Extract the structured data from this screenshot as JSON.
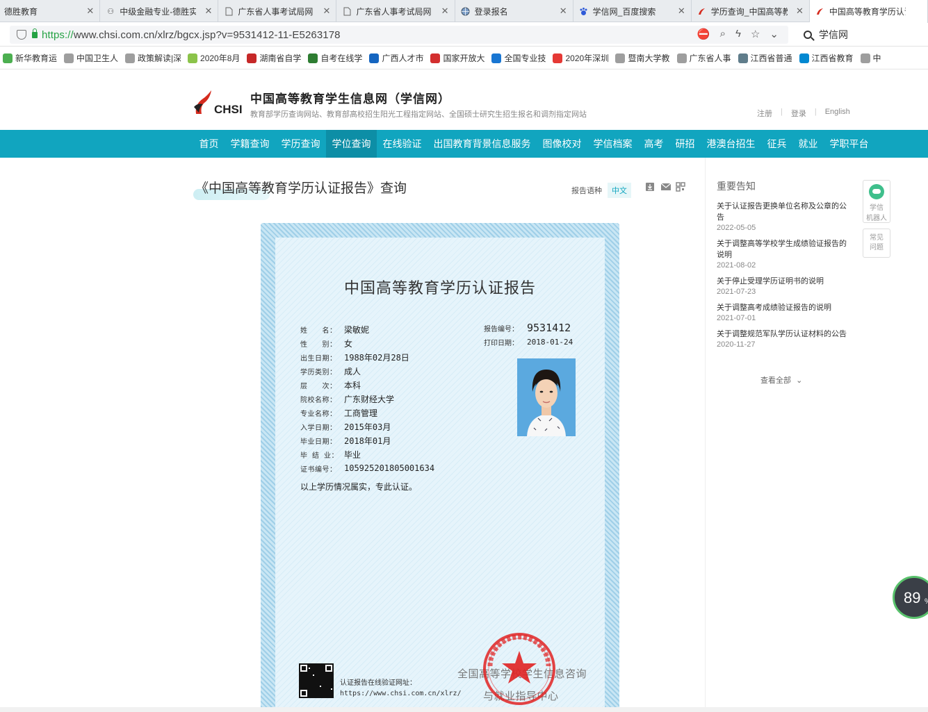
{
  "tabs": [
    {
      "label": "德胜教育",
      "icon": "none"
    },
    {
      "label": "中级金融专业-德胜实",
      "icon": "logo"
    },
    {
      "label": "广东省人事考试局网",
      "icon": "doc"
    },
    {
      "label": "广东省人事考试局网",
      "icon": "doc"
    },
    {
      "label": "登录报名",
      "icon": "globe"
    },
    {
      "label": "学信网_百度搜索",
      "icon": "baidu"
    },
    {
      "label": "学历查询_中国高等教",
      "icon": "chsi"
    },
    {
      "label": "中国高等教育学历认证",
      "icon": "chsi"
    }
  ],
  "address": {
    "scheme": "https://",
    "rest": "www.chsi.com.cn/xlrz/bgcx.jsp?v=9531412-11-E5263178",
    "search_text": "学信网"
  },
  "bookmarks": [
    {
      "label": "新华教育运",
      "color": "#4caf50"
    },
    {
      "label": "中国卫生人",
      "color": "#9e9e9e"
    },
    {
      "label": "政策解读|深",
      "color": "#9e9e9e"
    },
    {
      "label": "2020年8月",
      "color": "#8bc34a"
    },
    {
      "label": "湖南省自学",
      "color": "#c62828"
    },
    {
      "label": "自考在线学",
      "color": "#2e7d32"
    },
    {
      "label": "广西人才市",
      "color": "#1565c0"
    },
    {
      "label": "国家开放大",
      "color": "#d32f2f"
    },
    {
      "label": "全国专业技",
      "color": "#1976d2"
    },
    {
      "label": "2020年深圳",
      "color": "#e53935"
    },
    {
      "label": "暨南大学教",
      "color": "#9e9e9e"
    },
    {
      "label": "广东省人事",
      "color": "#9e9e9e"
    },
    {
      "label": "江西省普通",
      "color": "#607d8b"
    },
    {
      "label": "江西省教育",
      "color": "#0288d1"
    },
    {
      "label": "中",
      "color": "#9e9e9e"
    }
  ],
  "header": {
    "logo_text": "CHSI",
    "title": "中国高等教育学生信息网（学信网）",
    "subtitle": "教育部学历查询网站、教育部高校招生阳光工程指定网站、全国硕士研究生招生报名和调剂指定网站",
    "register": "注册",
    "login": "登录",
    "english": "English"
  },
  "nav": [
    "首页",
    "学籍查询",
    "学历查询",
    "学位查询",
    "在线验证",
    "出国教育背景信息服务",
    "图像校对",
    "学信档案",
    "高考",
    "研招",
    "港澳台招生",
    "征兵",
    "就业",
    "学职平台"
  ],
  "nav_active_index": 3,
  "main": {
    "page_title": "《中国高等教育学历认证报告》查询",
    "lang_label": "报告语种",
    "lang_value": "中文"
  },
  "certificate": {
    "title": "中国高等教育学历认证报告",
    "fields": [
      {
        "key": "姓　　名：",
        "value": "梁敏妮"
      },
      {
        "key": "性　　别：",
        "value": "女"
      },
      {
        "key": "出生日期：",
        "value": "1988年02月28日"
      },
      {
        "key": "学历类别：",
        "value": "成人"
      },
      {
        "key": "层　　次：",
        "value": "本科"
      },
      {
        "key": "院校名称：",
        "value": "广东财经大学"
      },
      {
        "key": "专业名称：",
        "value": "工商管理"
      },
      {
        "key": "入学日期：",
        "value": "2015年03月"
      },
      {
        "key": "毕业日期：",
        "value": "2018年01月"
      },
      {
        "key": "毕 结 业：",
        "value": "毕业"
      },
      {
        "key": "证书编号：",
        "value": "105925201805001634"
      }
    ],
    "statement": "以上学历情况属实，专此认证。",
    "report_no_label": "报告编号：",
    "report_no": "9531412",
    "print_date_label": "打印日期：",
    "print_date": "2018-01-24",
    "verify_label": "认证报告在线验证网址：",
    "verify_url": "https://www.chsi.com.cn/xlrz/",
    "issuer_line1": "全国高等学校学生信息咨询",
    "issuer_line2": "与就业指导中心"
  },
  "sidebar": {
    "title": "重要告知",
    "notices": [
      {
        "title": "关于认证报告更换单位名称及公章的公告",
        "date": "2022-05-05"
      },
      {
        "title": "关于调整高等学校学生成绩验证报告的说明",
        "date": "2021-08-02"
      },
      {
        "title": "关于停止受理学历证明书的说明",
        "date": "2021-07-23"
      },
      {
        "title": "关于调整高考成绩验证报告的说明",
        "date": "2021-07-01"
      },
      {
        "title": "关于调整规范军队学历认证材料的公告",
        "date": "2020-11-27"
      }
    ],
    "view_all": "查看全部",
    "robot_label1": "学信",
    "robot_label2": "机器人",
    "faq_label1": "常见",
    "faq_label2": "问题"
  },
  "speed_widget": {
    "value": "89",
    "unit": "%"
  }
}
